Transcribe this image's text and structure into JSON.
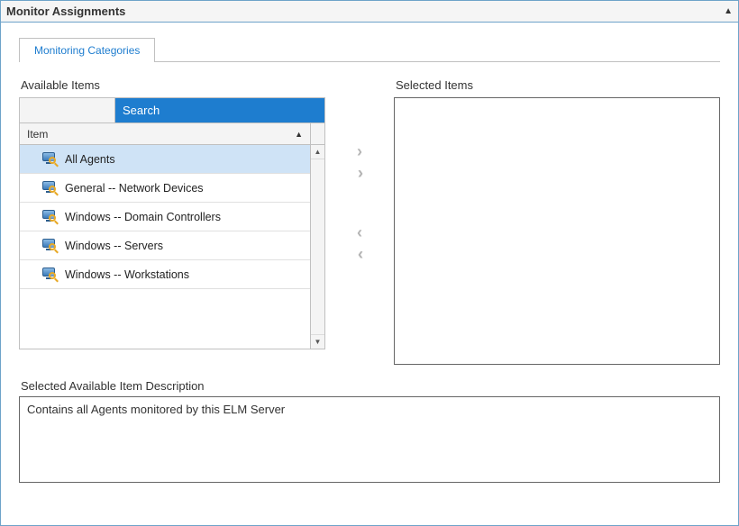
{
  "panel": {
    "title": "Monitor Assignments"
  },
  "tabs": [
    {
      "label": "Monitoring Categories",
      "active": true
    }
  ],
  "available": {
    "label": "Available Items",
    "search_placeholder": "Search",
    "column_header": "Item",
    "items": [
      {
        "label": "All Agents",
        "selected": true
      },
      {
        "label": "General -- Network Devices",
        "selected": false
      },
      {
        "label": "Windows -- Domain Controllers",
        "selected": false
      },
      {
        "label": "Windows -- Servers",
        "selected": false
      },
      {
        "label": "Windows -- Workstations",
        "selected": false
      }
    ]
  },
  "selected": {
    "label": "Selected Items",
    "items": []
  },
  "description": {
    "label": "Selected Available Item Description",
    "text": "Contains all Agents monitored by this ELM Server"
  }
}
